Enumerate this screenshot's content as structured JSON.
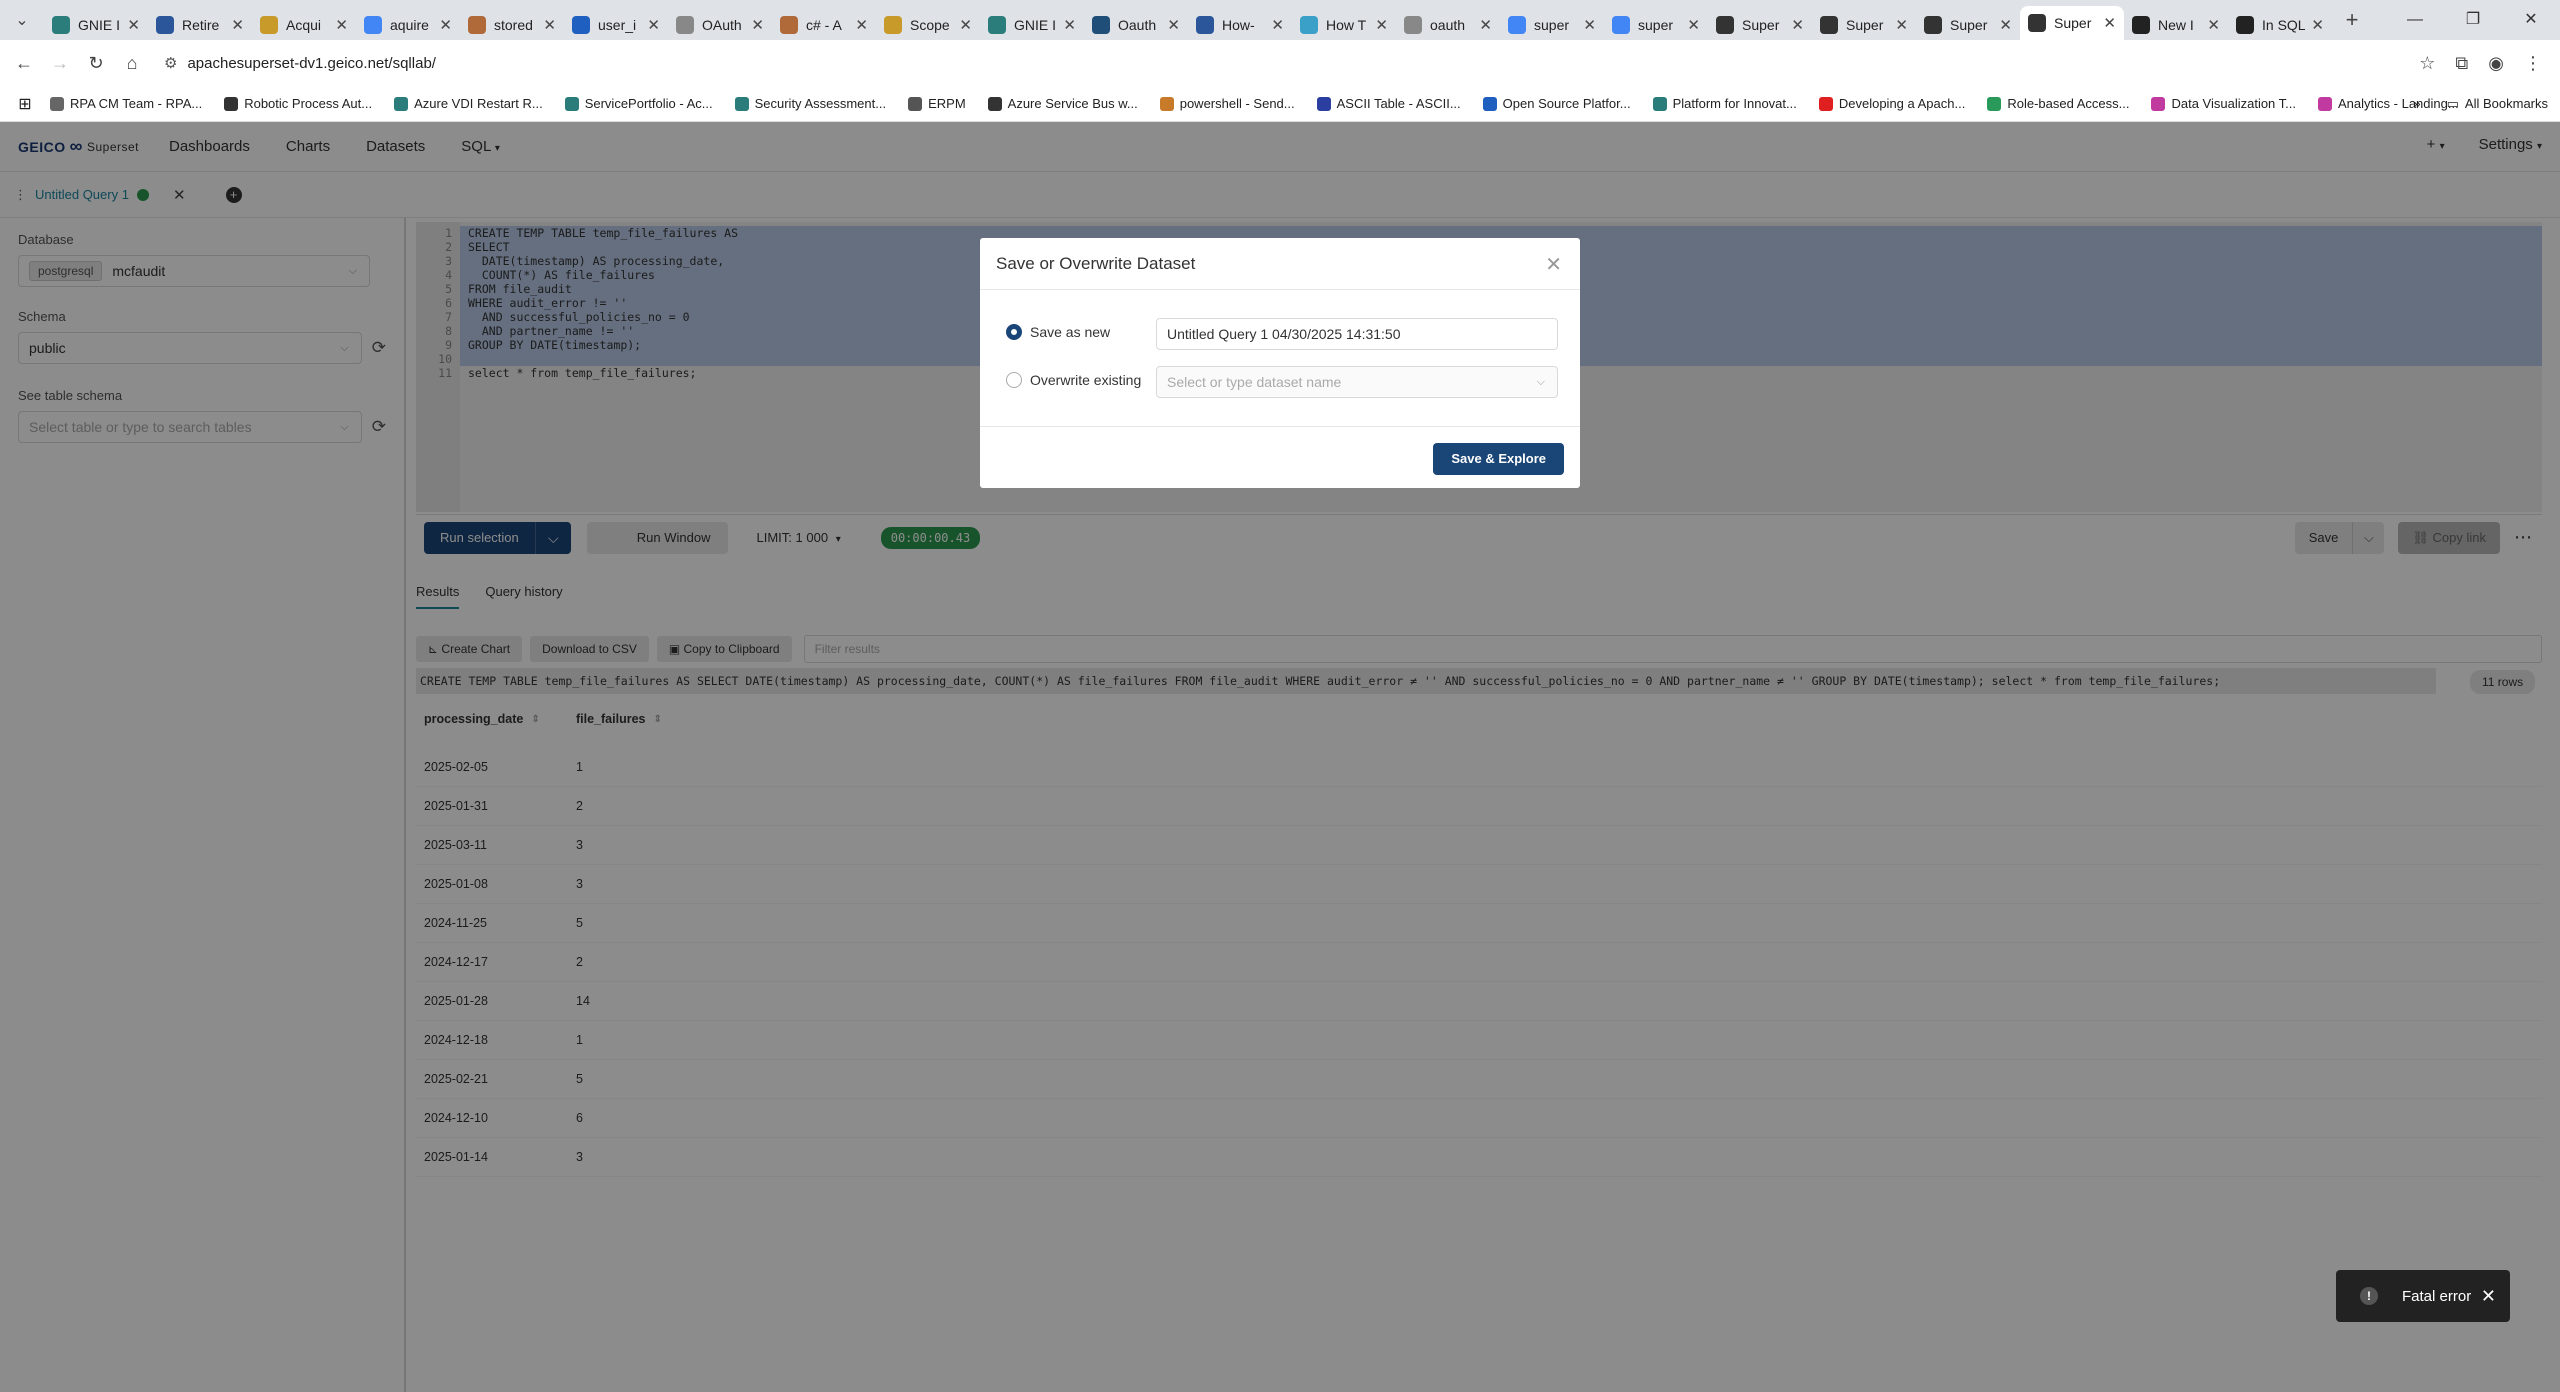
{
  "browser": {
    "tabs": [
      {
        "title": "GNIE I",
        "color": "#2a7d7a",
        "active": false
      },
      {
        "title": "Retire",
        "color": "#2b579a",
        "active": false
      },
      {
        "title": "Acqui",
        "color": "#c79a2a",
        "active": false
      },
      {
        "title": "aquire",
        "color": "#4285f4",
        "active": false
      },
      {
        "title": "stored",
        "color": "#b06a3a",
        "active": false
      },
      {
        "title": "user_i",
        "color": "#1f5fbf",
        "active": false
      },
      {
        "title": "OAuth",
        "color": "#888888",
        "active": false
      },
      {
        "title": "c# - A",
        "color": "#b06a3a",
        "active": false
      },
      {
        "title": "Scope",
        "color": "#c79a2a",
        "active": false
      },
      {
        "title": "GNIE I",
        "color": "#2a7d7a",
        "active": false
      },
      {
        "title": "Oauth",
        "color": "#1f4e79",
        "active": false
      },
      {
        "title": "How-",
        "color": "#2b579a",
        "active": false
      },
      {
        "title": "How T",
        "color": "#3aa0c8",
        "active": false
      },
      {
        "title": "oauth",
        "color": "#888888",
        "active": false
      },
      {
        "title": "super",
        "color": "#4285f4",
        "active": false
      },
      {
        "title": "super",
        "color": "#4285f4",
        "active": false
      },
      {
        "title": "Super",
        "color": "#333333",
        "active": false
      },
      {
        "title": "Super",
        "color": "#333333",
        "active": false
      },
      {
        "title": "Super",
        "color": "#333333",
        "active": false
      },
      {
        "title": "Super",
        "color": "#333333",
        "active": true
      },
      {
        "title": "New I",
        "color": "#222222",
        "active": false
      },
      {
        "title": "In SQL",
        "color": "#222222",
        "active": false
      }
    ],
    "url": "apachesuperset-dv1.geico.net/sqllab/",
    "bookmarks": [
      {
        "label": "RPA CM Team - RPA...",
        "color": "#666666"
      },
      {
        "label": "Robotic Process Aut...",
        "color": "#333333"
      },
      {
        "label": "Azure VDI Restart R...",
        "color": "#2a7d7a"
      },
      {
        "label": "ServicePortfolio - Ac...",
        "color": "#2a7d7a"
      },
      {
        "label": "Security Assessment...",
        "color": "#2a7d7a"
      },
      {
        "label": "ERPM",
        "color": "#555555"
      },
      {
        "label": "Azure Service Bus w...",
        "color": "#333333"
      },
      {
        "label": "powershell - Send...",
        "color": "#c77a2a"
      },
      {
        "label": "ASCII Table - ASCII...",
        "color": "#2b3fa0"
      },
      {
        "label": "Open Source Platfor...",
        "color": "#1f5fbf"
      },
      {
        "label": "Platform for Innovat...",
        "color": "#2a7d7a"
      },
      {
        "label": "Developing a Apach...",
        "color": "#e02020"
      },
      {
        "label": "Role-based Access...",
        "color": "#2a9a5a"
      },
      {
        "label": "Data Visualization T...",
        "color": "#c03aa0"
      },
      {
        "label": "Analytics - Landing...",
        "color": "#c03aa0"
      }
    ],
    "all_bookmarks": "All Bookmarks"
  },
  "app": {
    "logo": "GEICO",
    "logo_sub": "Superset",
    "menu": [
      "Dashboards",
      "Charts",
      "Datasets",
      "SQL"
    ],
    "nav_plus": "+",
    "settings": "Settings",
    "query_tab": "Untitled Query 1"
  },
  "left": {
    "database_label": "Database",
    "database_engine": "postgresql",
    "database_name": "mcfaudit",
    "schema_label": "Schema",
    "schema_value": "public",
    "table_label": "See table schema",
    "table_placeholder": "Select table or type to search tables"
  },
  "editor": {
    "line_numbers": [
      "1",
      "2",
      "3",
      "4",
      "5",
      "6",
      "7",
      "8",
      "9",
      "10",
      "11"
    ],
    "lines": [
      "CREATE TEMP TABLE temp_file_failures AS",
      "SELECT",
      "  DATE(timestamp) AS processing_date,",
      "  COUNT(*) AS file_failures",
      "FROM file_audit",
      "WHERE audit_error != ''",
      "  AND successful_policies_no = 0",
      "  AND partner_name != ''",
      "GROUP BY DATE(timestamp);",
      "",
      "select * from temp_file_failures;"
    ]
  },
  "toolbar": {
    "run_selection": "Run selection",
    "run_window": "Run Window",
    "limit_label": "LIMIT:",
    "limit_value": "1 000",
    "timer": "00:00:00.43",
    "save": "Save",
    "copy_link": "Copy link"
  },
  "results": {
    "tabs": [
      "Results",
      "Query history"
    ],
    "create_chart": "Create Chart",
    "download_csv": "Download to CSV",
    "copy_clipboard": "Copy to Clipboard",
    "filter_placeholder": "Filter results",
    "executed_sql": "CREATE TEMP TABLE temp_file_failures AS SELECT DATE(timestamp) AS processing_date, COUNT(*) AS file_failures FROM file_audit WHERE audit_error ≠ '' AND successful_policies_no = 0 AND partner_name ≠ '' GROUP BY DATE(timestamp); select * from temp_file_failures;",
    "rows_count": "11 rows",
    "columns": [
      "processing_date",
      "file_failures"
    ],
    "rows": [
      [
        "2025-02-05",
        "1"
      ],
      [
        "2025-01-31",
        "2"
      ],
      [
        "2025-03-11",
        "3"
      ],
      [
        "2025-01-08",
        "3"
      ],
      [
        "2024-11-25",
        "5"
      ],
      [
        "2024-12-17",
        "2"
      ],
      [
        "2025-01-28",
        "14"
      ],
      [
        "2024-12-18",
        "1"
      ],
      [
        "2025-02-21",
        "5"
      ],
      [
        "2024-12-10",
        "6"
      ],
      [
        "2025-01-14",
        "3"
      ]
    ]
  },
  "modal": {
    "title": "Save or Overwrite Dataset",
    "save_new_label": "Save as new",
    "save_new_value": "Untitled Query 1 04/30/2025 14:31:50",
    "overwrite_label": "Overwrite existing",
    "overwrite_placeholder": "Select or type dataset name",
    "submit": "Save & Explore"
  },
  "toast": {
    "message": "Fatal error"
  }
}
